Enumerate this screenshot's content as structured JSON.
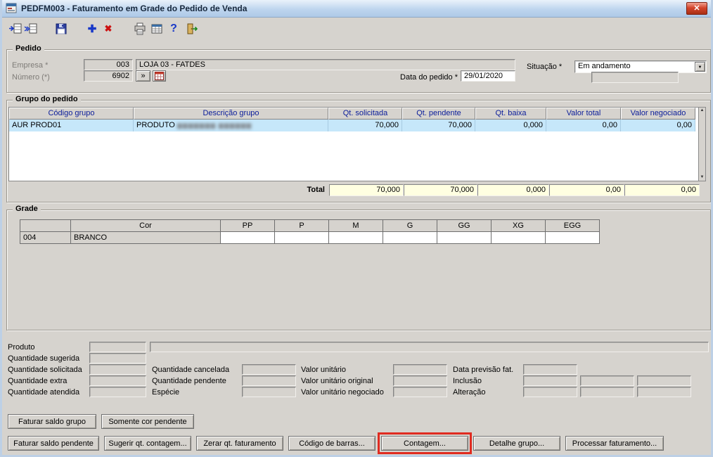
{
  "window": {
    "title": "PEDFM003 - Faturamento em Grade do Pedido de Venda",
    "close_glyph": "✕"
  },
  "toolbar": {
    "icons": [
      "fetch-record-icon",
      "fetch-records-icon",
      "save-icon",
      "add-icon",
      "delete-icon",
      "print-icon",
      "table-icon",
      "help-icon",
      "exit-icon"
    ],
    "add_glyph": "✚",
    "delete_glyph": "✖",
    "help_glyph": "?"
  },
  "pedido": {
    "legend": "Pedido",
    "empresa_label": "Empresa *",
    "empresa_code": "003",
    "empresa_name": "LOJA 03 - FATDES",
    "numero_label": "Número (*)",
    "numero_value": "6902",
    "more_glyph": "»",
    "data_label": "Data do pedido *",
    "data_value": "29/01/2020",
    "situacao_label": "Situação *",
    "situacao_value": "Em andamento",
    "combo_arrow": "▼"
  },
  "grupo": {
    "legend": "Grupo do pedido",
    "columns": [
      "Código grupo",
      "Descrição grupo",
      "Qt. solicitada",
      "Qt. pendente",
      "Qt. baixa",
      "Valor total",
      "Valor  negociado"
    ],
    "row": {
      "codigo": "AUR PROD01",
      "descricao_prefix": "PRODUTO ",
      "descricao_redacted": "▆▆▆▆▆▆▆ ▆▆▆▆▆▆",
      "qt_solicitada": "70,000",
      "qt_pendente": "70,000",
      "qt_baixa": "0,000",
      "valor_total": "0,00",
      "valor_negociado": "0,00"
    },
    "total_label": "Total",
    "totals": [
      "70,000",
      "70,000",
      "0,000",
      "0,00",
      "0,00"
    ]
  },
  "grade": {
    "legend": "Grade",
    "columns": [
      "",
      "Cor",
      "PP",
      "P",
      "M",
      "G",
      "GG",
      "XG",
      "EGG"
    ],
    "row": [
      "004",
      "BRANCO",
      "",
      "",
      "",
      "",
      "",
      "",
      ""
    ]
  },
  "detail": {
    "produto": "Produto",
    "qt_sugerida": "Quantidade sugerida",
    "qt_solicitada": "Quantidade solicitada",
    "qt_extra": "Quantidade extra",
    "qt_atendida": "Quantidade atendida",
    "qt_cancelada": "Quantidade cancelada",
    "qt_pendente": "Quantidade pendente",
    "especie": "Espécie",
    "valor_unitario": "Valor unitário",
    "valor_unitario_original": "Valor unitário original",
    "valor_unitario_negociado": "Valor unitário negociado",
    "data_previsao": "Data previsão fat.",
    "inclusao": "Inclusão",
    "alteracao": "Alteração"
  },
  "buttons": {
    "faturar_saldo_grupo": "Faturar saldo grupo",
    "somente_cor_pendente": "Somente cor pendente",
    "faturar_saldo_pendente": "Faturar saldo pendente",
    "sugerir_qt_contagem": "Sugerir qt. contagem...",
    "zerar_qt_faturamento": "Zerar qt. faturamento",
    "codigo_de_barras": "Código de barras...",
    "contagem": "Contagem...",
    "detalhe_grupo": "Detalhe grupo...",
    "processar_faturamento": "Processar faturamento..."
  },
  "colors": {
    "selected_row": "#c6e7fa",
    "total_bg": "#ffffe1",
    "annotation": "#e02b20",
    "header_text": "#0a1c9a",
    "window_bg": "#d6d3ce"
  }
}
